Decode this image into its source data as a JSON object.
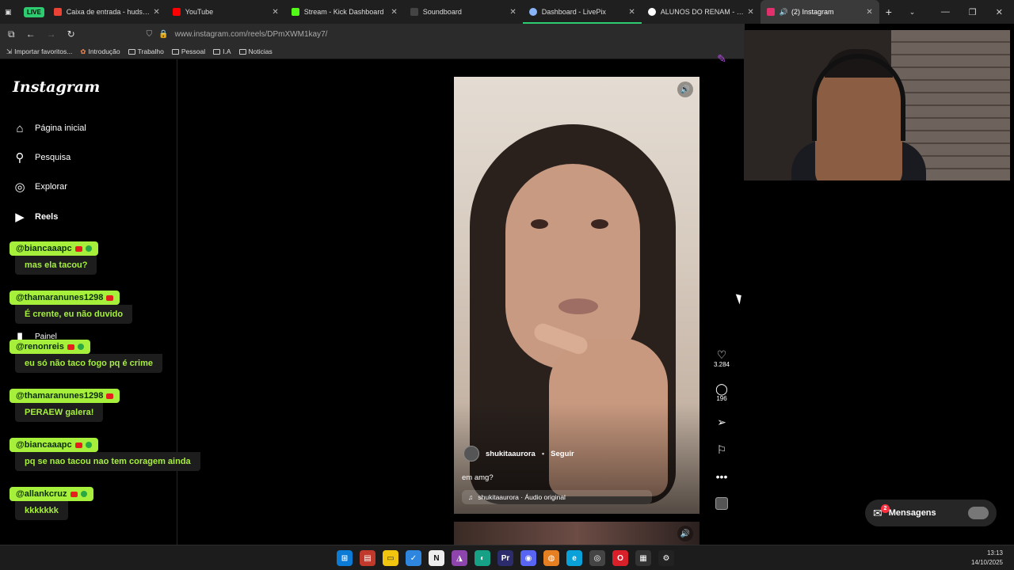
{
  "browser": {
    "live_badge": "LIVE",
    "tabs": [
      {
        "title": "Caixa de entrada - hudsonfabio",
        "color": "#ea4335"
      },
      {
        "title": "YouTube",
        "color": "#ff0000"
      },
      {
        "title": "Stream - Kick Dashboard",
        "color": "#53fc18"
      },
      {
        "title": "Soundboard",
        "color": "#444444"
      },
      {
        "title": "Dashboard - LivePix",
        "color": "#8ab4f8"
      },
      {
        "title": "ALUNOS DO RENAM - Pesquisa",
        "color": "#ffffff"
      },
      {
        "title": "(2) Instagram",
        "color": "#e1306c"
      }
    ],
    "url": "www.instagram.com/reels/DPmXWM1kay7/",
    "bookmarks": [
      "Importar favoritos...",
      "Introdução",
      "Trabalho",
      "Pessoal",
      "I.A",
      "Noticias"
    ]
  },
  "instagram": {
    "logo": "Instagram",
    "nav": [
      "Página inicial",
      "Pesquisa",
      "Explorar",
      "Reels"
    ],
    "hidden_item": "Painel",
    "reel": {
      "author": "shukitaaurora",
      "follow": "Seguir",
      "caption": "em amg?",
      "audio": "shukitaaurora · Áudio original",
      "likes": "3.284",
      "comments": "196"
    },
    "messages_label": "Mensagens",
    "messages_badge": "2"
  },
  "chat": [
    {
      "user": "@biancaaapc",
      "message": "mas ela tacou?"
    },
    {
      "user": "@thamaranunes1298",
      "message": "É crente, eu não duvido"
    },
    {
      "user": "@renonreis",
      "message": "eu só não taco fogo pq é crime"
    },
    {
      "user": "@thamaranunes1298",
      "message": "PERAEW galera!"
    },
    {
      "user": "@biancaaapc",
      "message": "pq se nao tacou nao tem coragem ainda"
    },
    {
      "user": "@allankcruz",
      "message": "kkkkkkk"
    }
  ],
  "taskbar": {
    "time": "13:13",
    "date": "14/10/2025"
  }
}
